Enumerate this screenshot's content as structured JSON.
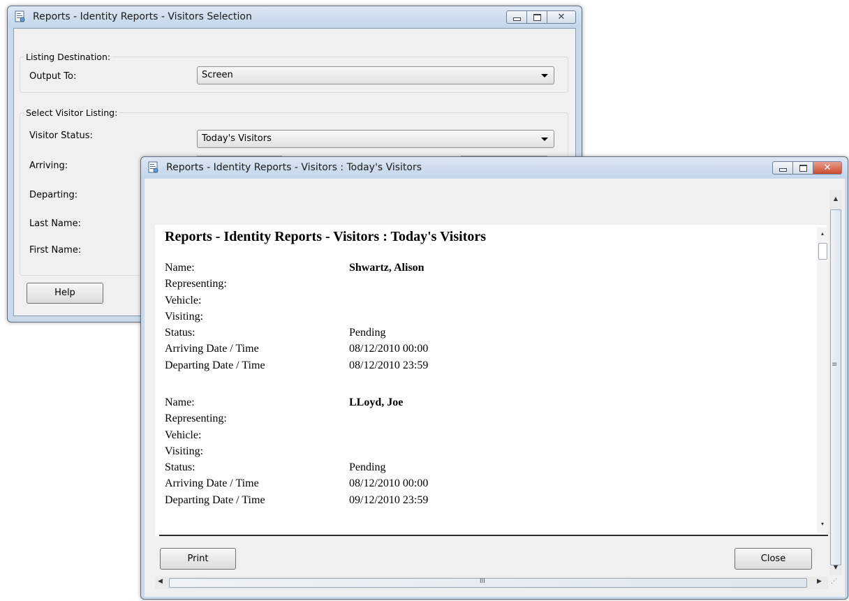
{
  "selection_window": {
    "title": "Reports - Identity Reports - Visitors Selection",
    "listing_destination": {
      "group_label": "Listing Destination:",
      "output_label": "Output To:",
      "output_value": "Screen"
    },
    "visitor_listing": {
      "group_label": "Select Visitor Listing:",
      "status_label": "Visitor Status:",
      "status_value": "Today's Visitors",
      "arriving_label": "Arriving:",
      "departing_label": "Departing:",
      "last_name_label": "Last Name:",
      "first_name_label": "First Name:"
    },
    "help_label": "Help"
  },
  "report_window": {
    "title": "Reports - Identity Reports - Visitors : Today's Visitors",
    "heading": "Reports - Identity Reports - Visitors : Today's Visitors",
    "field_labels": {
      "name": "Name:",
      "representing": "Representing:",
      "vehicle": "Vehicle:",
      "visiting": "Visiting:",
      "status": "Status:",
      "arriving": "Arriving Date / Time",
      "departing": "Departing Date / Time"
    },
    "records": [
      {
        "name": "Shwartz, Alison",
        "status": "Pending",
        "arriving": "08/12/2010 00:00",
        "departing": "08/12/2010 23:59"
      },
      {
        "name": "LLoyd, Joe",
        "status": "Pending",
        "arriving": "08/12/2010 00:00",
        "departing": "09/12/2010 23:59"
      }
    ],
    "print_label": "Print",
    "close_label": "Close",
    "hscroll_grip": "III"
  },
  "icons": {
    "window_icon": "report-document-icon",
    "minimize": "minimize-icon",
    "maximize": "maximize-icon",
    "close": "close-icon"
  },
  "colors": {
    "title_bar": "#c9d9ea",
    "close_button_active": "#c94a2f",
    "client_bg": "#f0f0f0"
  }
}
